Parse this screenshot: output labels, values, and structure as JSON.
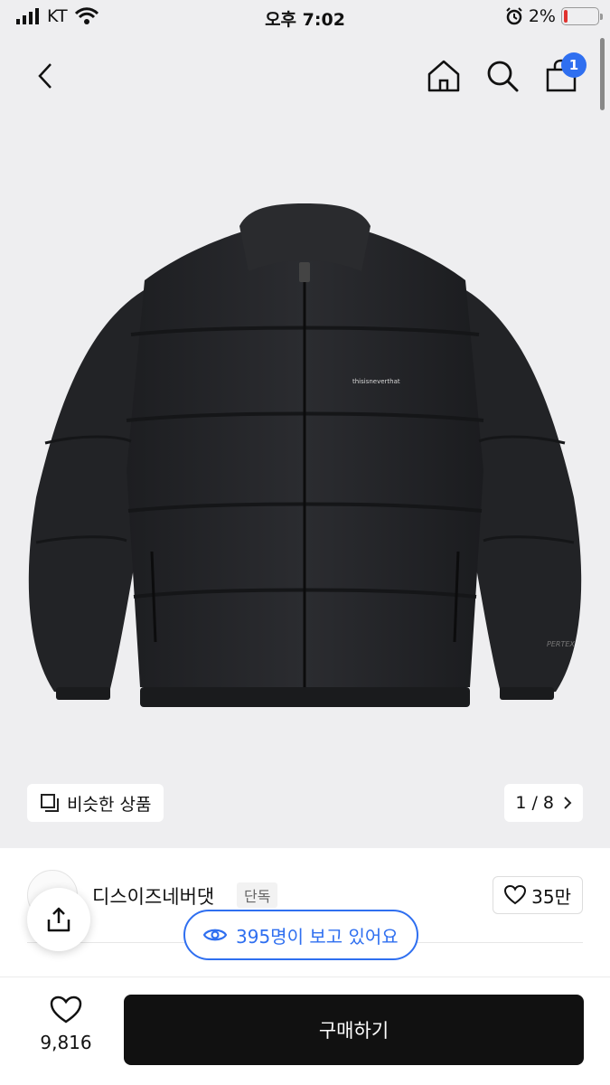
{
  "status_bar": {
    "carrier": "KT",
    "time": "오후 7:02",
    "battery_percent": "2%",
    "battery_level": 0.02
  },
  "nav": {
    "back_icon": "chevron-left-icon",
    "home_icon": "home-icon",
    "search_icon": "search-icon",
    "cart_icon": "shopping-bag-icon",
    "cart_count": "1"
  },
  "gallery": {
    "similar_label": "비슷한 상품",
    "page_indicator": "1 / 8",
    "product_logo_text": "thisisneverthat",
    "sleeve_text": "PERTEX"
  },
  "shop": {
    "brand_name": "디스이즈네버댓",
    "exclusive_badge": "단독",
    "like_count": "35만"
  },
  "viewers": {
    "text": "395명이 보고 있어요"
  },
  "bottom": {
    "wish_count": "9,816",
    "buy_label": "구매하기"
  },
  "colors": {
    "accent": "#2f6ff0",
    "buy_button": "#111111",
    "battery_low": "#e0322f"
  }
}
